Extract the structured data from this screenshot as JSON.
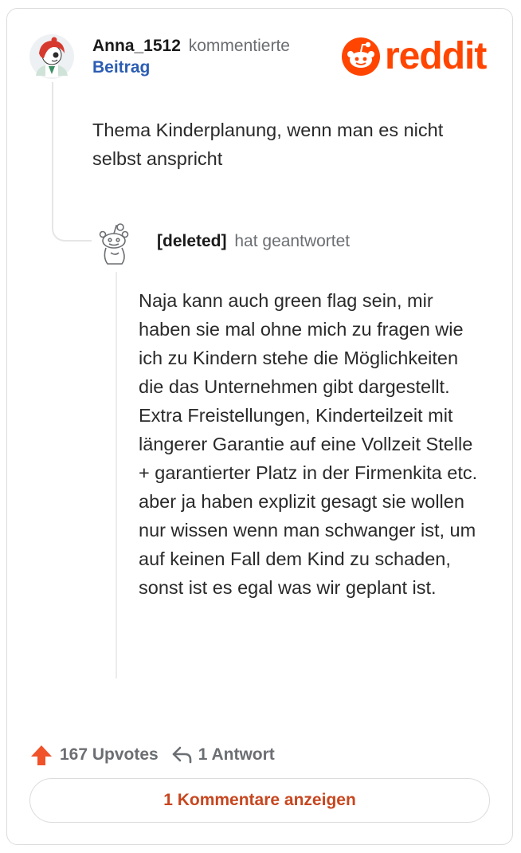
{
  "brand": {
    "logo_text": "reddit",
    "accent_color": "#ff4500"
  },
  "comment": {
    "username": "Anna_1512",
    "action": "kommentierte",
    "post_link": "Beitrag",
    "text": "Thema Kinderplanung, wenn man es nicht selbst anspricht"
  },
  "reply": {
    "username": "[deleted]",
    "action": "hat geantwortet",
    "text": "Naja kann auch green flag sein, mir haben sie mal ohne mich zu fragen wie ich zu Kindern stehe die Möglichkeiten die das Unternehmen gibt dargestellt. Extra Freistellungen, Kinderteilzeit mit längerer Garantie auf eine Vollzeit Stelle + garantierter Platz in der Firmenkita etc. aber ja haben explizit gesagt sie wollen nur wissen wenn man schwanger ist, um auf keinen Fall dem Kind zu schaden, sonst ist es egal was wir geplant ist."
  },
  "actions": {
    "upvotes_label": "167 Upvotes",
    "replies_label": "1 Antwort",
    "upvote_icon": "upvote-arrow-icon",
    "reply_icon": "reply-arrow-icon"
  },
  "footer": {
    "show_comments_label": "1 Kommentare anzeigen"
  }
}
